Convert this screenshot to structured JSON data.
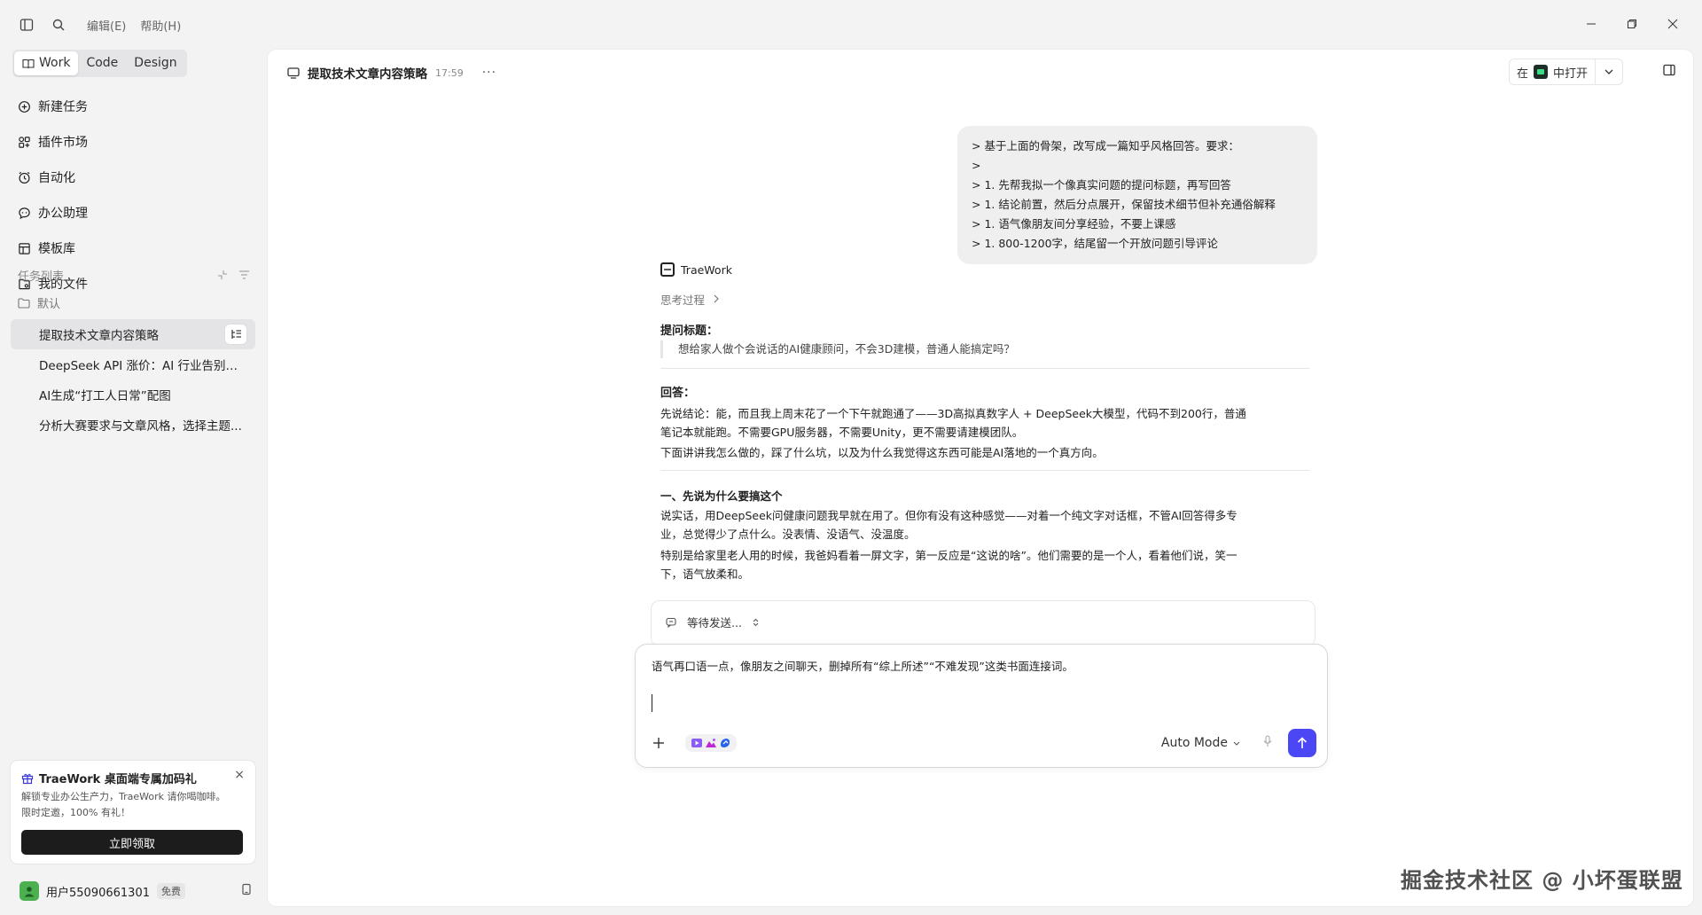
{
  "menu": {
    "edit": "编辑(E)",
    "help": "帮助(H)"
  },
  "modes": [
    {
      "label": "Work"
    },
    {
      "label": "Code"
    },
    {
      "label": "Design"
    }
  ],
  "nav": [
    {
      "label": "新建任务",
      "icon": "new-task-icon"
    },
    {
      "label": "插件市场",
      "icon": "plugin-market-icon"
    },
    {
      "label": "自动化",
      "icon": "automation-clock-icon"
    },
    {
      "label": "办公助理",
      "icon": "chat-bubble-icon"
    },
    {
      "label": "模板库",
      "icon": "template-icon"
    },
    {
      "label": "我的文件",
      "icon": "file-icon"
    }
  ],
  "tasks": {
    "heading": "任务列表",
    "folder": "默认",
    "items": [
      "提取技术文章内容策略",
      "DeepSeek API 涨价：AI 行业告别白...",
      "AI生成“打工人日常”配图",
      "分析大赛要求与文章风格，选择主题..."
    ]
  },
  "promo": {
    "title": "TraeWork 桌面端专属加码礼",
    "desc_line1": "解锁专业办公生产力，TraeWork 请你喝咖啡。",
    "desc_line2": "限时定邀，100% 有礼！",
    "button": "立即领取",
    "close": "×"
  },
  "user": {
    "name": "用户55090661301",
    "plan": "免费"
  },
  "conversation": {
    "title": "提取技术文章内容策略",
    "time": "17:59",
    "more": "···",
    "open_in_prefix": "在",
    "open_in_suffix": "中打开"
  },
  "user_message": [
    "> 基于上面的骨架，改写成一篇知乎风格回答。要求：",
    ">",
    "> 1. 先帮我拟一个像真实问题的提问标题，再写回答",
    "> 1. 结论前置，然后分点展开，保留技术细节但补充通俗解释",
    "> 1. 语气像朋友间分享经验，不要上课感",
    "> 1. 800-1200字，结尾留一个开放问题引导评论"
  ],
  "assistant": {
    "name": "TraeWork",
    "thinking": "思考过程",
    "question_label": "提问标题：",
    "question": "想给家人做个会说话的AI健康顾问，不会3D建模，普通人能搞定吗？",
    "answer_label": "回答：",
    "p1_l1": "先说结论：能，而且我上周末花了一个下午就跑通了——3D高拟真数字人 + DeepSeek大模型，代码不到200行，普通",
    "p1_l2": "笔记本就能跑。不需要GPU服务器，不需要Unity，更不需要请建模团队。",
    "p2": "下面讲讲我怎么做的，踩了什么坑，以及为什么我觉得这东西可能是AI落地的一个真方向。",
    "section1": "一、先说为什么要搞这个",
    "p3_l1": "说实话，用DeepSeek问健康问题我早就在用了。但你有没有这种感觉——对着一个纯文字对话框，不管AI回答得多专",
    "p3_l2": "业，总觉得少了点什么。没表情、没语气、没温度。",
    "p4_l1": "特别是给家里老人用的时候，我爸妈看着一屏文字，第一反应是“这说的啥”。他们需要的是一个人，看着他们说，笑一",
    "p4_l2": "下，语气放柔和。"
  },
  "pending": {
    "label": "等待发送..."
  },
  "composer": {
    "text": "语气再口语一点，像朋友之间聊天，删掉所有“综上所述”“不难发现”这类书面连接词。",
    "mode": "Auto Mode"
  },
  "watermark": "掘金技术社区 @ 小坏蛋联盟",
  "colors": {
    "accent": "#4b47f5",
    "app_icon_green": "#3ddc84"
  }
}
